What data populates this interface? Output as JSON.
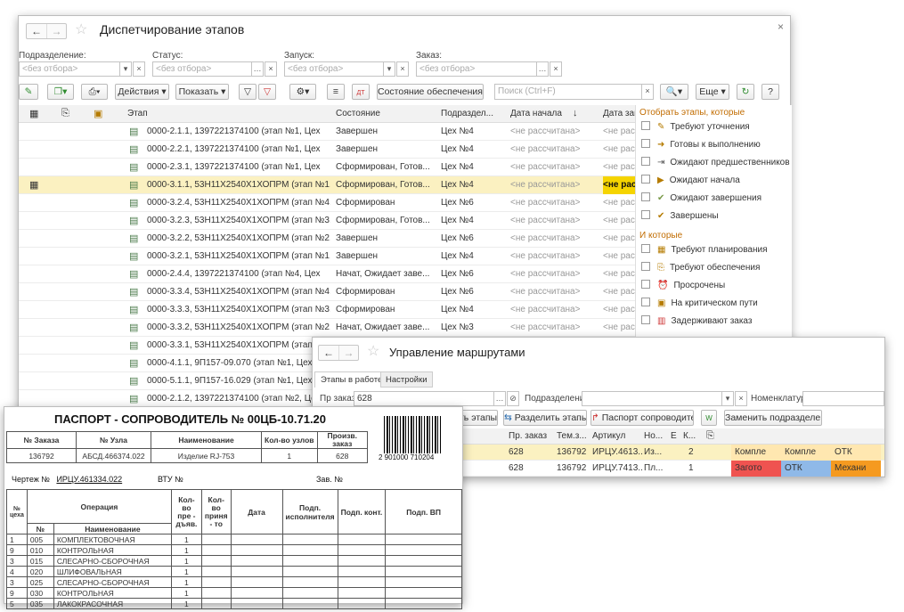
{
  "main": {
    "title": "Диспетчирование этапов",
    "close": "×",
    "filters": [
      {
        "label": "Подразделение:",
        "placeholder": "<без отбора>"
      },
      {
        "label": "Статус:",
        "placeholder": "<без отбора>"
      },
      {
        "label": "Запуск:",
        "placeholder": "<без отбора>"
      },
      {
        "label": "Заказ:",
        "placeholder": "<без отбора>"
      }
    ],
    "toolbar": {
      "actions": "Действия",
      "show": "Показать",
      "supply": "Состояние обеспечения",
      "search_placeholder": "Поиск (Ctrl+F)",
      "more": "Еще",
      "help": "?"
    },
    "columns": [
      "Этап",
      "Состояние",
      "Подраздел...",
      "Дата начала",
      "Дата заве"
    ],
    "rows": [
      {
        "stage": "0000-2.1.1, 1397221374100 (этап №1, Цех",
        "state": "Завершен",
        "dept": "Цех №4",
        "start": "<не рассчитана>",
        "end": "<не расс",
        "hl": false
      },
      {
        "stage": "0000-2.2.1, 1397221374100 (этап №1, Цех",
        "state": "Завершен",
        "dept": "Цех №4",
        "start": "<не рассчитана>",
        "end": "<не расс",
        "hl": false
      },
      {
        "stage": "0000-2.3.1, 1397221374100 (этап №1, Цех",
        "state": "Сформирован, Готов...",
        "dept": "Цех №4",
        "start": "<не рассчитана>",
        "end": "<не расс",
        "hl": false
      },
      {
        "stage": "0000-3.1.1, 53Н11Х2540Х1ХОПРМ (этап №1...",
        "state": "Сформирован, Готов...",
        "dept": "Цех №4",
        "start": "<не рассчитана>",
        "end": "<не расс",
        "hl": true
      },
      {
        "stage": "0000-3.2.4, 53Н11Х2540Х1ХОПРМ (этап №4...",
        "state": "Сформирован",
        "dept": "Цех №6",
        "start": "<не рассчитана>",
        "end": "<не расс",
        "hl": false
      },
      {
        "stage": "0000-3.2.3, 53Н11Х2540Х1ХОПРМ (этап №3...",
        "state": "Сформирован, Готов...",
        "dept": "Цех №4",
        "start": "<не рассчитана>",
        "end": "<не расс",
        "hl": false
      },
      {
        "stage": "0000-3.2.2, 53Н11Х2540Х1ХОПРМ (этап №2...",
        "state": "Завершен",
        "dept": "Цех №6",
        "start": "<не рассчитана>",
        "end": "<не расс",
        "hl": false
      },
      {
        "stage": "0000-3.2.1, 53Н11Х2540Х1ХОПРМ (этап №1...",
        "state": "Завершен",
        "dept": "Цех №4",
        "start": "<не рассчитана>",
        "end": "<не расс",
        "hl": false
      },
      {
        "stage": "0000-2.4.4, 1397221374100 (этап №4, Цех",
        "state": "Начат, Ожидает заве...",
        "dept": "Цех №6",
        "start": "<не рассчитана>",
        "end": "<не расс",
        "hl": false
      },
      {
        "stage": "0000-3.3.4, 53Н11Х2540Х1ХОПРМ (этап №4...",
        "state": "Сформирован",
        "dept": "Цех №6",
        "start": "<не рассчитана>",
        "end": "<не расс",
        "hl": false
      },
      {
        "stage": "0000-3.3.3, 53Н11Х2540Х1ХОПРМ (этап №3...",
        "state": "Сформирован",
        "dept": "Цех №4",
        "start": "<не рассчитана>",
        "end": "<не расс",
        "hl": false
      },
      {
        "stage": "0000-3.3.2, 53Н11Х2540Х1ХОПРМ (этап №2...",
        "state": "Начат, Ожидает заве...",
        "dept": "Цех №3",
        "start": "<не рассчитана>",
        "end": "<не расс",
        "hl": false
      },
      {
        "stage": "0000-3.3.1, 53Н11Х2540Х1ХОПРМ (этап №1...",
        "state": "",
        "dept": "",
        "start": "",
        "end": "",
        "hl": false
      },
      {
        "stage": "0000-4.1.1, 9П157-09.070 (этап №1, Цех №",
        "state": "",
        "dept": "",
        "start": "",
        "end": "",
        "hl": false
      },
      {
        "stage": "0000-5.1.1, 9П157-16.029 (этап №1, Цех №",
        "state": "",
        "dept": "",
        "start": "",
        "end": "",
        "hl": false
      },
      {
        "stage": "0000-2.1.2, 1397221374100 (этап №2, Цех",
        "state": "",
        "dept": "",
        "start": "",
        "end": "",
        "hl": false
      }
    ],
    "panel": {
      "title1": "Отобрать этапы, которые",
      "items1": [
        "Требуют уточнения",
        "Готовы к выполнению",
        "Ожидают предшественников",
        "Ожидают начала",
        "Ожидают завершения",
        "Завершены"
      ],
      "title2": "И которые",
      "items2": [
        "Требуют планирования",
        "Требуют обеспечения",
        "Просрочены",
        "На критическом пути",
        "Задерживают заказ"
      ]
    }
  },
  "routes": {
    "title": "Управление маршрутами",
    "tabs": [
      "Этапы в работе",
      "Настройки"
    ],
    "order_label": "Пр заказ:",
    "order_value": "628",
    "dept_label": "Подразделение:",
    "nom_label": "Номенклатура:",
    "buttons": [
      "ть этапы",
      "Разделить этапы",
      "Паспорт сопроводитель",
      "Заменить подразделение"
    ],
    "columns": [
      "Пр. заказ",
      "Тем.з...",
      "Артикул",
      "Но...",
      "Е",
      "К..."
    ],
    "rows": [
      {
        "c": [
          "628",
          "136792",
          "ИРЦУ.4613...",
          "Из...",
          "",
          "2"
        ],
        "s": [
          "Компле",
          "Компле",
          "ОТК"
        ]
      },
      {
        "c": [
          "628",
          "136792",
          "ИРЦУ.7413...",
          "Пл...",
          "",
          "1"
        ],
        "s": [
          "Загото",
          "ОТК",
          "Механи"
        ]
      }
    ]
  },
  "passport": {
    "title": "ПАСПОРТ - СОПРОВОДИТЕЛЬ № 00ЦБ-10.71.20",
    "head": [
      "№ Заказа",
      "№ Узла",
      "Наименование",
      "Кол-во узлов",
      "Произв. заказ"
    ],
    "vals": [
      "136792",
      "АБСД.466374.022",
      "Изделие RJ-753",
      "1",
      "628"
    ],
    "barcode": "2 901000 710204",
    "drawing_label": "Чертеж №",
    "drawing": "ИРЦУ.461334.022",
    "vtu": "ВТУ №",
    "zav": "Зав. №",
    "op_head": [
      "№ цеха",
      "Операция",
      "Кол-во пре - дъяв.",
      "Кол-во приня - то",
      "Дата",
      "Подп. исполнителя",
      "Подп. конт.",
      "Подп. ВП"
    ],
    "op_sub": [
      "№",
      "Наименование"
    ],
    "ops": [
      [
        "1",
        "005",
        "КОМПЛЕКТОВОЧНАЯ",
        "1"
      ],
      [
        "9",
        "010",
        "КОНТРОЛЬНАЯ",
        "1"
      ],
      [
        "3",
        "015",
        "СЛЕСАРНО-СБОРОЧНАЯ",
        "1"
      ],
      [
        "4",
        "020",
        "ШЛИФОВАЛЬНАЯ",
        "1"
      ],
      [
        "3",
        "025",
        "СЛЕСАРНО-СБОРОЧНАЯ",
        "1"
      ],
      [
        "9",
        "030",
        "КОНТРОЛЬНАЯ",
        "1"
      ],
      [
        "5",
        "035",
        "ЛАКОКРАСОЧНАЯ",
        "1"
      ]
    ]
  }
}
